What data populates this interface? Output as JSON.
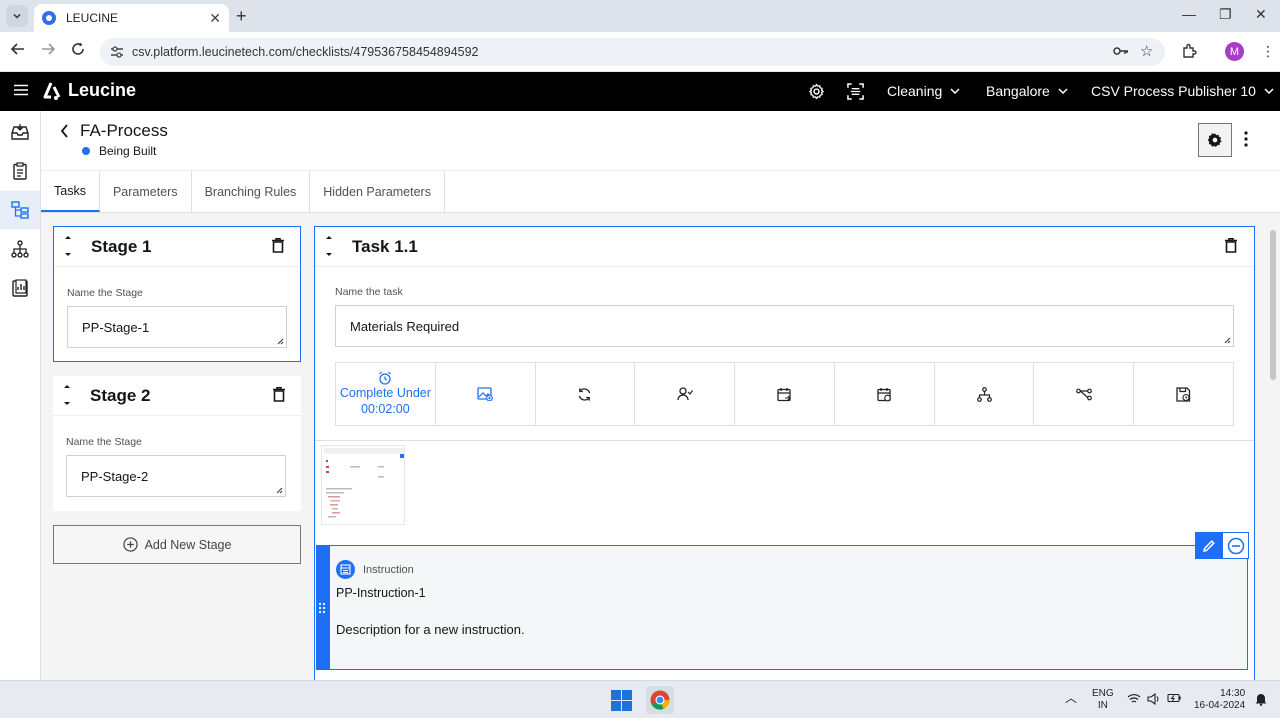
{
  "browser": {
    "tab_title": "LEUCINE",
    "url": "csv.platform.leucinetech.com/checklists/479536758454894592",
    "profile_initial": "M"
  },
  "app": {
    "brand": "Leucine",
    "facility": "Cleaning",
    "location": "Bangalore",
    "user": "CSV Process Publisher 10"
  },
  "page": {
    "title": "FA-Process",
    "status": "Being Built"
  },
  "tabs": [
    "Tasks",
    "Parameters",
    "Branching Rules",
    "Hidden Parameters"
  ],
  "stages": [
    {
      "title": "Stage 1",
      "label": "Name the Stage",
      "value": "PP-Stage-1"
    },
    {
      "title": "Stage 2",
      "label": "Name the Stage",
      "value": "PP-Stage-2"
    }
  ],
  "add_stage_label": "Add New Stage",
  "task": {
    "title": "Task 1.1",
    "label": "Name the task",
    "value": "Materials Required",
    "timer_label": "Complete Under",
    "timer_value": "00:02:00"
  },
  "instruction": {
    "type": "Instruction",
    "name": "PP-Instruction-1",
    "description": "Description for a new instruction."
  },
  "taskbar": {
    "lang": "ENG",
    "region": "IN",
    "time": "14:30",
    "date": "16-04-2024"
  },
  "colors": {
    "accent": "#1d70f5",
    "header": "#000000"
  }
}
